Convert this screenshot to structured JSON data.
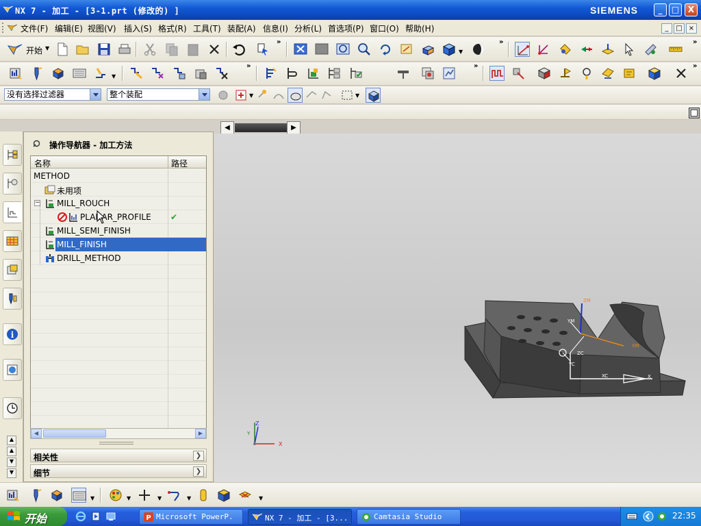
{
  "window": {
    "title": "NX 7 - 加工 - [3-1.prt (修改的) ]",
    "brand": "SIEMENS",
    "controls": {
      "minimize": "_",
      "maximize": "□",
      "close": "X"
    }
  },
  "menubar": {
    "items": [
      "文件(F)",
      "编辑(E)",
      "视图(V)",
      "插入(S)",
      "格式(R)",
      "工具(T)",
      "装配(A)",
      "信息(I)",
      "分析(L)",
      "首选项(P)",
      "窗口(O)",
      "帮助(H)"
    ],
    "mdi": [
      "_",
      "□",
      "×"
    ]
  },
  "toolbar": {
    "start_label": "开始",
    "more": "»"
  },
  "filters": {
    "selection_filter": "没有选择过滤器",
    "scope": "整个装配"
  },
  "navigator": {
    "title": "操作导航器 - 加工方法",
    "columns": {
      "name": "名称",
      "path": "路径"
    },
    "rows": [
      {
        "name": "METHOD",
        "level": 0
      },
      {
        "name": "未用项",
        "level": 1
      },
      {
        "name": "MILL_ROUCH",
        "level": 1
      },
      {
        "name": "PLANAR_PROFILE",
        "level": 2,
        "path_status": "✔"
      },
      {
        "name": "MILL_SEMI_FINISH",
        "level": 1
      },
      {
        "name": "MILL_FINISH",
        "level": 1,
        "selected": true
      },
      {
        "name": "DRILL_METHOD",
        "level": 1
      }
    ],
    "sections": {
      "dependencies": "相关性",
      "details": "细节"
    }
  },
  "viewport": {
    "axis_labels": {
      "zm": "ZM",
      "ym": "YM",
      "xm": "XM",
      "zc": "ZC",
      "yc": "YC",
      "xc": "XC",
      "x": "X"
    },
    "triad": {
      "z": "Z",
      "y": "Y",
      "x": "X"
    },
    "colors": {
      "part": "#5a5a5a",
      "accent_orange": "#e08a1e",
      "axis_blue": "#1f2fd0"
    }
  },
  "taskbar": {
    "start": "开始",
    "tasks": [
      {
        "label": "Microsoft PowerP.",
        "active": false
      },
      {
        "label": "NX 7 - 加工 - [3...",
        "active": true
      },
      {
        "label": "Camtasia Studio",
        "active": false
      }
    ],
    "clock": "22:35"
  }
}
